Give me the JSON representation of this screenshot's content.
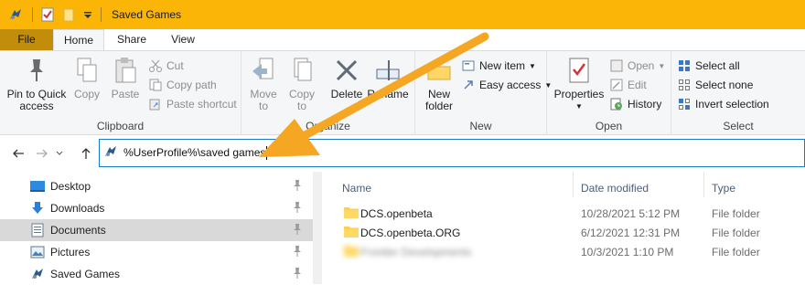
{
  "window": {
    "title": "Saved Games"
  },
  "tabs": {
    "file": "File",
    "home": "Home",
    "share": "Share",
    "view": "View"
  },
  "ribbon": {
    "clipboard": {
      "label": "Clipboard",
      "pin": "Pin to Quick access",
      "pin_line1": "Pin to Quick",
      "pin_line2": "access",
      "copy": "Copy",
      "paste": "Paste",
      "cut": "Cut",
      "copy_path": "Copy path",
      "paste_shortcut": "Paste shortcut"
    },
    "organize": {
      "label": "Organize",
      "move_to": "Move",
      "move_to2": "to",
      "copy_to": "Copy",
      "copy_to2": "to",
      "delete": "Delete",
      "rename": "Rename"
    },
    "new": {
      "label": "New",
      "new_folder1": "New",
      "new_folder2": "folder",
      "new_item": "New item",
      "easy_access": "Easy access"
    },
    "open": {
      "label": "Open",
      "properties": "Properties",
      "open": "Open",
      "edit": "Edit",
      "history": "History"
    },
    "select": {
      "label": "Select",
      "select_all": "Select all",
      "select_none": "Select none",
      "invert": "Invert selection"
    }
  },
  "address": {
    "value": "%UserProfile%\\saved games"
  },
  "navpane": {
    "items": [
      {
        "label": "Desktop"
      },
      {
        "label": "Downloads"
      },
      {
        "label": "Documents"
      },
      {
        "label": "Pictures"
      },
      {
        "label": "Saved Games"
      }
    ]
  },
  "columns": {
    "name": "Name",
    "date": "Date modified",
    "type": "Type"
  },
  "files": [
    {
      "name": "DCS.openbeta",
      "date": "10/28/2021 5:12 PM",
      "type": "File folder"
    },
    {
      "name": "DCS.openbeta.ORG",
      "date": "6/12/2021 12:31 PM",
      "type": "File folder"
    },
    {
      "name": "Frontier Developments",
      "date": "10/3/2021 1:10 PM",
      "type": "File folder"
    }
  ],
  "colors": {
    "titlebar": "#fbb507",
    "arrow": "#f5a623",
    "accent": "#1979ca"
  }
}
